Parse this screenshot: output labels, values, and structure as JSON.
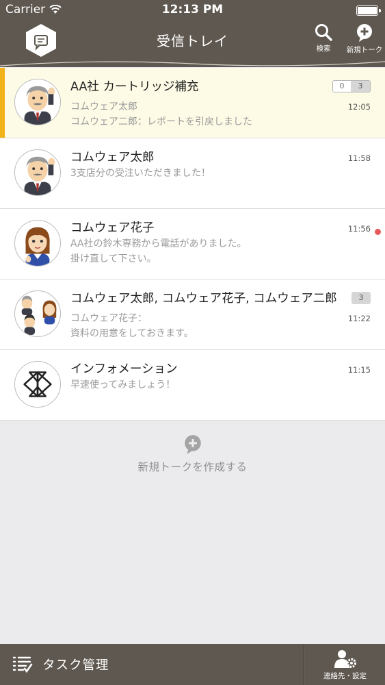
{
  "status": {
    "carrier": "Carrier",
    "time": "12:13 PM"
  },
  "nav": {
    "title": "受信トレイ",
    "search_label": "検索",
    "new_talk_label": "新規トーク"
  },
  "conversations": [
    {
      "title": "AA社 カートリッジ補充",
      "line1": "コムウェア太郎",
      "line2": "コムウェア二郎：レポートを引戻しました",
      "time": "12:05",
      "read_count": "0",
      "total_count": "3",
      "highlighted": true,
      "avatar": "man-avatar"
    },
    {
      "title": "コムウェア太郎",
      "line1": "3支店分の受注いただきました！",
      "line2": "",
      "time": "11:58",
      "avatar": "man-avatar"
    },
    {
      "title": "コムウェア花子",
      "line1": "AA社の鈴木専務から電話がありました。",
      "line2": "掛け直して下さい。",
      "time": "11:56",
      "unread_dot": true,
      "avatar": "woman-avatar"
    },
    {
      "title": "コムウェア太郎, コムウェア花子, コムウェア二郎",
      "line1": "コムウェア花子：",
      "line2": "資料の用意をしておきます。",
      "time": "11:22",
      "count": "3",
      "avatar": "group-avatar"
    },
    {
      "title": "インフォメーション",
      "line1": "早速使ってみましょう！",
      "line2": "",
      "time": "11:15",
      "avatar": "info-logo-avatar"
    }
  ],
  "new_talk": {
    "label": "新規トークを作成する"
  },
  "bottom": {
    "task_label": "タスク管理",
    "contacts_label": "連絡先・設定"
  },
  "colors": {
    "bar": "#5f5850",
    "accent": "#f2b21a",
    "highlight_bg": "#fdfbe6",
    "unread_dot": "#e55a5a"
  }
}
